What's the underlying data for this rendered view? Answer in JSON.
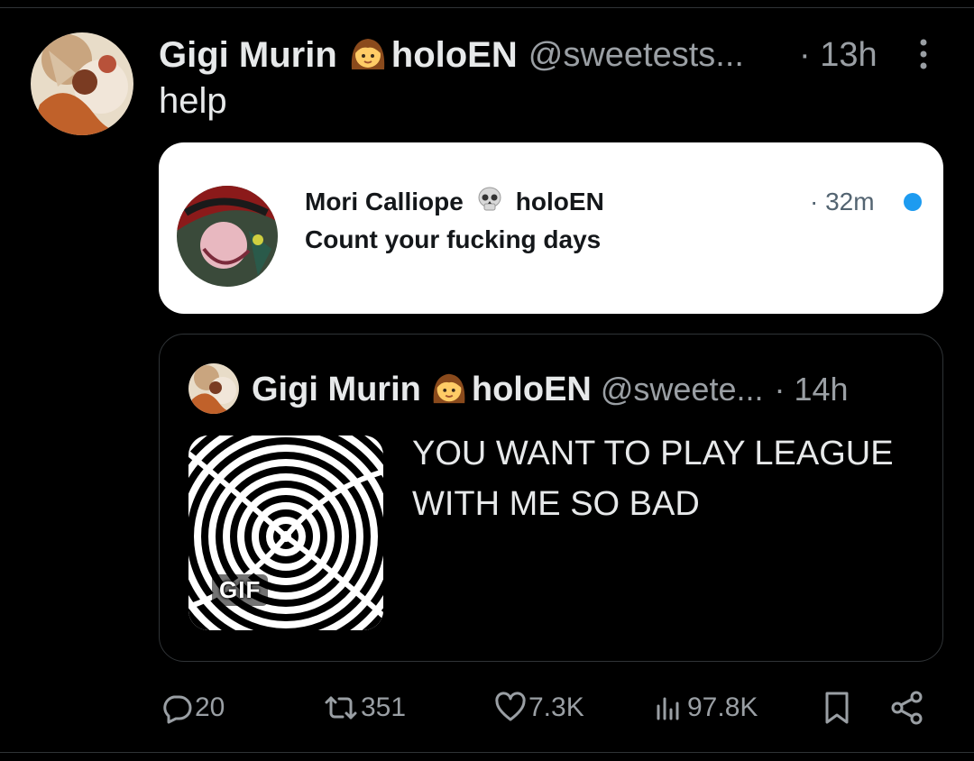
{
  "post": {
    "author_name": "Gigi Murin",
    "author_suffix": "holoEN",
    "author_handle": "@sweetests...",
    "time": "· 13h",
    "text": "help"
  },
  "quoted_card": {
    "author_name": "Mori Calliope",
    "author_suffix": "holoEN",
    "time": "· 32m",
    "text": "Count your fucking days"
  },
  "embedded_post": {
    "author_name": "Gigi Murin",
    "author_suffix": "holoEN",
    "author_handle": "@sweete...",
    "time": "· 14h",
    "media_label": "GIF",
    "text": "YOU WANT TO PLAY LEAGUE WITH ME SO BAD"
  },
  "actions": {
    "replies": "20",
    "reposts": "351",
    "likes": "7.3K",
    "views": "97.8K"
  },
  "icons": {
    "reply": "reply-icon",
    "repost": "repost-icon",
    "like": "heart-icon",
    "views": "views-icon",
    "bookmark": "bookmark-icon",
    "share": "share-icon",
    "more": "more-icon",
    "emoji_girl": "girl-emoji-icon",
    "emoji_skull": "skull-emoji-icon"
  },
  "colors": {
    "background": "#000000",
    "text": "#e7e9ea",
    "muted": "#9a9fa4",
    "card_bg": "#ffffff",
    "verified_dot": "#1d9bf0"
  }
}
